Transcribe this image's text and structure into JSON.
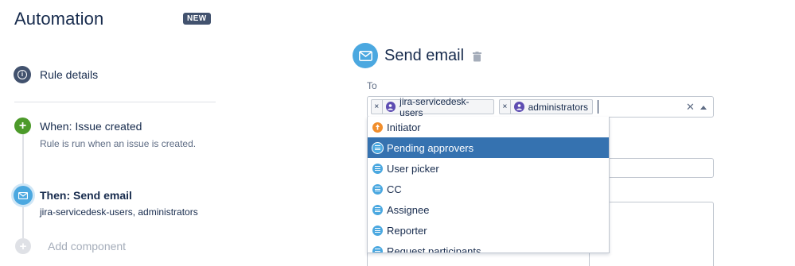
{
  "app": {
    "title": "Automation",
    "badge": "NEW"
  },
  "rule": {
    "details_label": "Rule details",
    "when": {
      "title": "When: Issue created",
      "description": "Rule is run when an issue is created."
    },
    "then": {
      "title": "Then: Send email",
      "description": "jira-servicedesk-users, administrators"
    },
    "add_component_label": "Add component"
  },
  "editor": {
    "title": "Send email",
    "to_label": "To",
    "recipients": [
      {
        "label": "jira-servicedesk-users",
        "icon": "group-avatar-icon"
      },
      {
        "label": "administrators",
        "icon": "group-avatar-icon"
      }
    ]
  },
  "dropdown": {
    "options": [
      {
        "label": "Initiator",
        "icon": "initiator-icon"
      },
      {
        "label": "Pending approvers",
        "icon": "field-icon",
        "selected": true
      },
      {
        "label": "User picker",
        "icon": "field-icon"
      },
      {
        "label": "CC",
        "icon": "field-icon"
      },
      {
        "label": "Assignee",
        "icon": "field-icon"
      },
      {
        "label": "Reporter",
        "icon": "field-icon"
      },
      {
        "label": "Request participants",
        "icon": "field-icon"
      }
    ]
  },
  "colors": {
    "accent": "#4ba8e0",
    "selected": "#3572b0",
    "success": "#4c9a2a",
    "text": "#172b4d",
    "badge": "#42526e"
  }
}
